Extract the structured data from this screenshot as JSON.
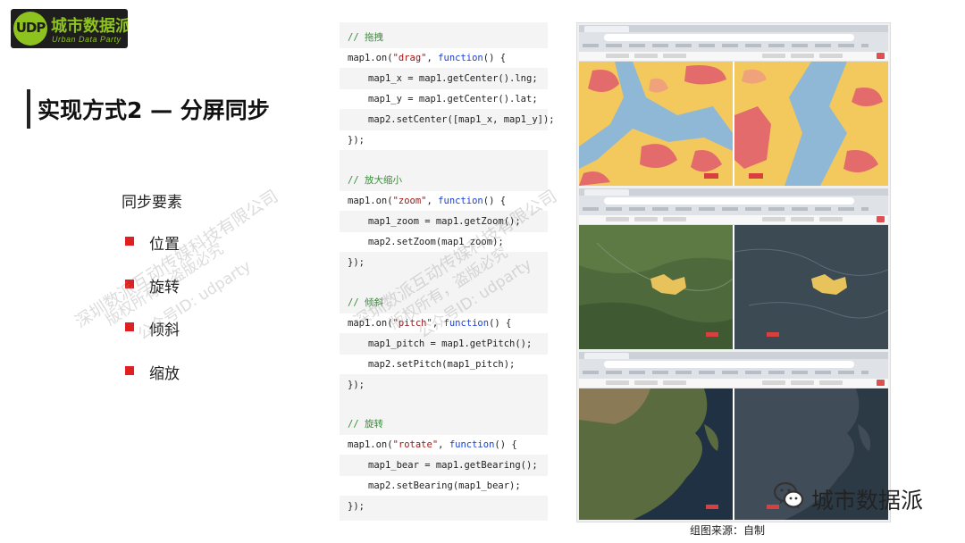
{
  "logo": {
    "mark": "UDP",
    "name": "城市数据派",
    "tagline": "Urban Data Party"
  },
  "slide": {
    "title": "实现方式2 — 分屏同步",
    "sync_heading": "同步要素",
    "sync_items": [
      "位置",
      "旋转",
      "倾斜",
      "缩放"
    ]
  },
  "code": {
    "blocks": [
      {
        "comment": "// 拖拽",
        "open_pre": "map1.on(",
        "event": "\"drag\"",
        "open_mid": ", ",
        "kw": "function",
        "open_post": "() {",
        "body": [
          "map1_x = map1.getCenter().lng;",
          "map1_y = map1.getCenter().lat;",
          "map2.setCenter([map1_x, map1_y]);"
        ]
      },
      {
        "comment": "// 放大缩小",
        "open_pre": "map1.on(",
        "event": "\"zoom\"",
        "open_mid": ", ",
        "kw": "function",
        "open_post": "() {",
        "body": [
          "map1_zoom = map1.getZoom();",
          "map2.setZoom(map1_zoom);"
        ]
      },
      {
        "comment": "// 倾斜",
        "open_pre": "map1.on(",
        "event": "\"pitch\"",
        "open_mid": ", ",
        "kw": "function",
        "open_post": "() {",
        "body": [
          "map1_pitch = map1.getPitch();",
          "map2.setPitch(map1_pitch);"
        ]
      },
      {
        "comment": "// 旋转",
        "open_pre": "map1.on(",
        "event": "\"rotate\"",
        "open_mid": ", ",
        "kw": "function",
        "open_post": "() {",
        "body": [
          "map1_bear = map1.getBearing();",
          "map2.setBearing(map1_bear);"
        ]
      }
    ],
    "close": "});"
  },
  "footer": {
    "wechat_name": "城市数据派",
    "caption": "组图来源：自制"
  },
  "watermark": {
    "lines_a": [
      "深圳数派互动传媒科技有限公司",
      "版权所有，盗版必究",
      "公众号ID: udparty"
    ],
    "lines_b": [
      "深圳数派互动传媒科技有限公司",
      "版权所有，盗版必究",
      "公众号ID: udparty"
    ]
  },
  "colors": {
    "accent_red": "#e02020",
    "logo_green": "#8ec21f",
    "comment_green": "#3a8a3a",
    "string_red": "#a31515",
    "keyword_blue": "#1a3fd8"
  }
}
